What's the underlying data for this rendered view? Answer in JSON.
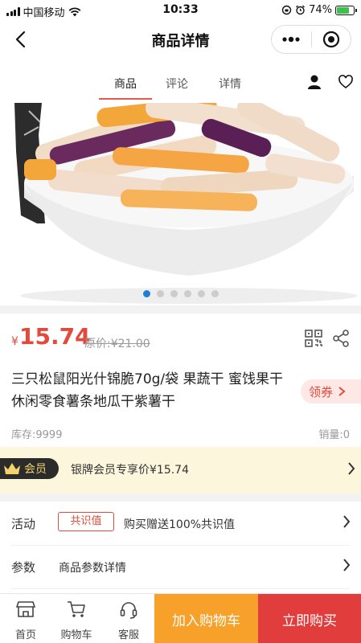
{
  "status_bar": {
    "carrier": "中国移动",
    "time": "10:33",
    "battery": "74%",
    "battery_level": 0.74
  },
  "nav": {
    "title": "商品详情"
  },
  "tabs": [
    {
      "label": "商品",
      "active": true
    },
    {
      "label": "评论",
      "active": false
    },
    {
      "label": "详情",
      "active": false
    }
  ],
  "carousel": {
    "total": 6,
    "active_index": 0
  },
  "product": {
    "currency": "¥",
    "price": "15.74",
    "original_price": "原价:¥21.00",
    "name": "三只松鼠阳光什锦脆70g/袋 果蔬干 蜜饯果干休闲零食薯条地瓜干紫薯干",
    "coupon_label": "领券",
    "stock": "库存:9999",
    "sales": "销量:0"
  },
  "member": {
    "badge": "会员",
    "text": "银牌会员专享价¥15.74"
  },
  "rows": {
    "activity": {
      "label": "活动",
      "tag": "共识值",
      "value": "购买赠送100%共识值"
    },
    "params": {
      "label": "参数",
      "value": "商品参数详情"
    }
  },
  "bottom_bar": {
    "home": "首页",
    "cart": "购物车",
    "service": "客服",
    "add_to_cart": "加入购物车",
    "buy_now": "立即购买"
  },
  "colors": {
    "accent_red": "#e24b3b",
    "cart_orange": "#f7a12b",
    "buy_red": "#e23d3d",
    "member_bg": "#fbf6dc"
  }
}
